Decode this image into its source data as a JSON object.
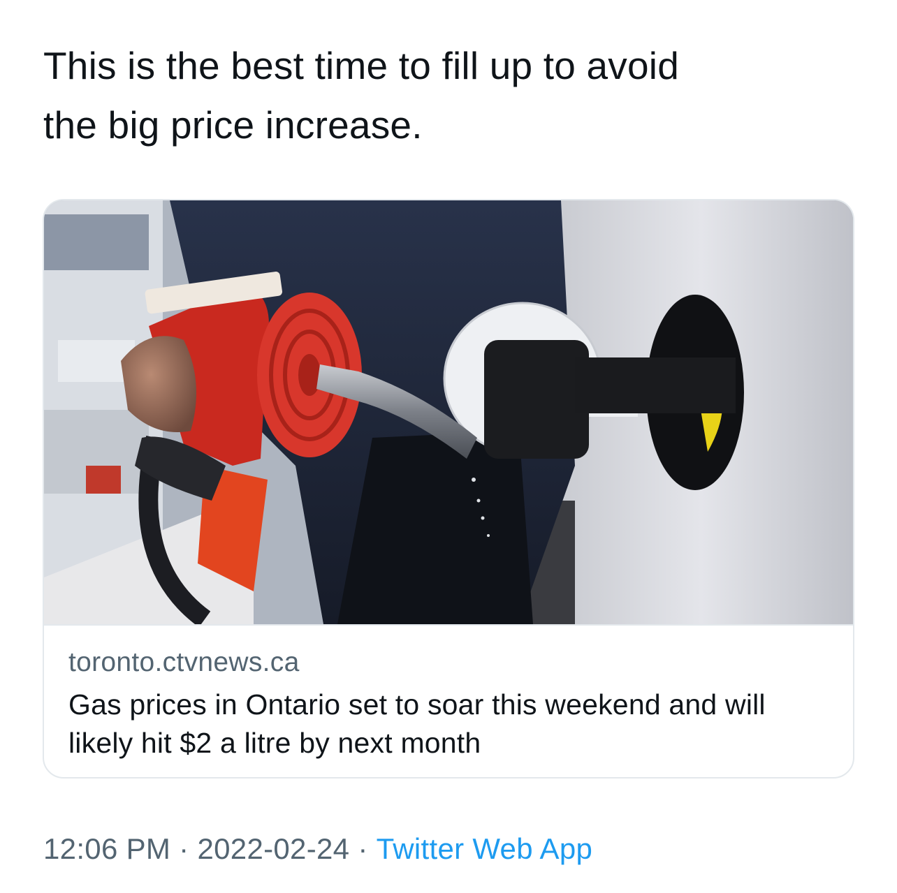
{
  "tweet": {
    "text": "This is the best time to fill up to avoid\nthe big price increase."
  },
  "card": {
    "image_icon": "gas-pump-nozzle-photo",
    "domain": "toronto.ctvnews.ca",
    "title": "Gas prices in Ontario set to soar this weekend and will likely hit $2 a litre by next month"
  },
  "meta": {
    "time": "12:06 PM",
    "date": "2022-02-24",
    "source": "Twitter Web App",
    "separator": "·"
  },
  "colors": {
    "text": "#0f1419",
    "secondary": "#536471",
    "link": "#1d9bf0",
    "border": "#e3e8ec",
    "nozzle_red": "#d8372c"
  }
}
